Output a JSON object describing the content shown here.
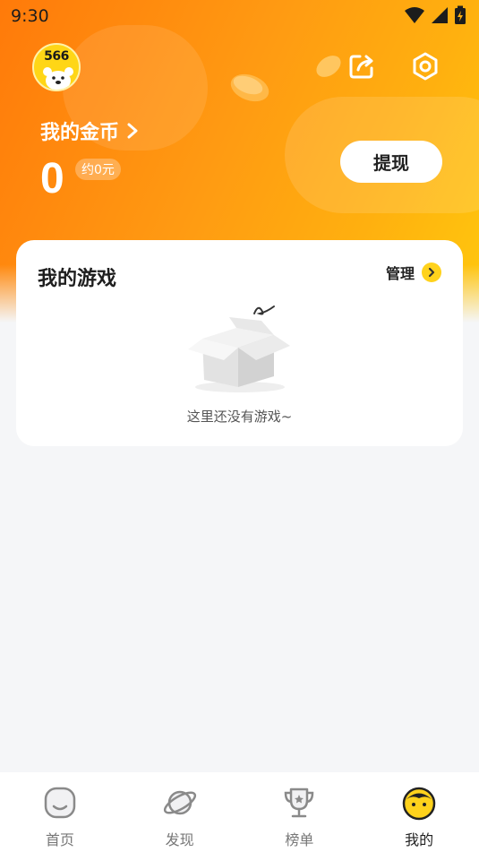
{
  "status_bar": {
    "time": "9:30"
  },
  "profile": {
    "avatar_text": "566"
  },
  "coins": {
    "title": "我的金币",
    "value": "0",
    "approx": "约0元",
    "withdraw_label": "提现"
  },
  "games_card": {
    "title": "我的游戏",
    "manage_label": "管理",
    "empty_text": "这里还没有游戏~"
  },
  "tabbar": {
    "tabs": [
      {
        "label": "首页",
        "icon": "home-face-icon",
        "active": false
      },
      {
        "label": "发现",
        "icon": "planet-icon",
        "active": false
      },
      {
        "label": "榜单",
        "icon": "trophy-icon",
        "active": false
      },
      {
        "label": "我的",
        "icon": "profile-face-icon",
        "active": true
      }
    ]
  },
  "colors": {
    "header_start": "#ff7a0a",
    "header_end": "#ffc80d",
    "accent_yellow": "#ffd21c",
    "background": "#f5f6f8"
  }
}
